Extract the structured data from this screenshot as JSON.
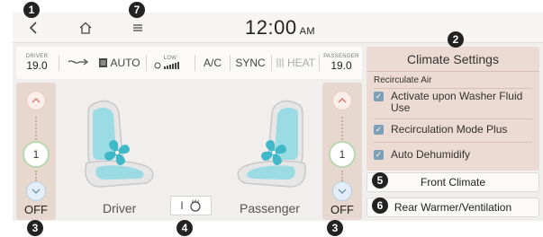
{
  "topbar": {
    "back_icon": "chevron-left-icon",
    "home_icon": "home-icon",
    "menu_icon": "menu-icon",
    "time": "12:00",
    "ampm": "AM"
  },
  "status": {
    "driver_label": "DRIVER",
    "driver_temp": "19.0",
    "fan_mode_icon": "airflow-icon",
    "auto_label": "AUTO",
    "fan_low_label": "LOW",
    "ac_label": "A/C",
    "sync_label": "SYNC",
    "heat_label": "HEAT",
    "passenger_label": "PASSENGER",
    "passenger_temp": "19.0"
  },
  "seats": {
    "driver": {
      "level": "1",
      "off_label": "OFF",
      "name": "Driver"
    },
    "passenger": {
      "level": "1",
      "off_label": "OFF",
      "name": "Passenger"
    },
    "wheel_bar": "I"
  },
  "settings": {
    "title": "Climate Settings",
    "section": "Recirculate Air",
    "options": [
      {
        "label": "Activate upon Washer Fluid Use",
        "checked": true
      },
      {
        "label": "Recirculation Mode Plus",
        "checked": true
      },
      {
        "label": "Auto Dehumidify",
        "checked": true
      }
    ]
  },
  "buttons": {
    "front_climate": "Front Climate",
    "rear": "Rear Warmer/Ventilation"
  },
  "callouts": [
    "1",
    "2",
    "3",
    "4",
    "5",
    "6",
    "7",
    "3"
  ],
  "colors": {
    "accent_panel": "#ecdbd2",
    "checkbox": "#7ba0b7",
    "seat_vent": "#56c8d4"
  }
}
